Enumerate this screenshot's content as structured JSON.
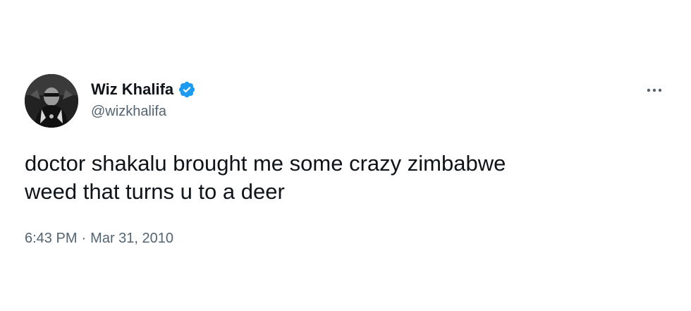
{
  "tweet": {
    "author": {
      "display_name": "Wiz Khalifa",
      "handle": "@wizkhalifa",
      "verified_icon": "verified-badge-icon",
      "avatar_icon": "profile-photo"
    },
    "text": "doctor shakalu brought me some crazy zimbabwe\nweed that turns u to a deer",
    "time": "6:43 PM",
    "separator": "·",
    "date": "Mar 31, 2010",
    "more_icon": "more-options-icon"
  },
  "colors": {
    "text_primary": "#0f1419",
    "text_secondary": "#536471",
    "verified_blue": "#1d9bf0",
    "background": "#ffffff"
  }
}
